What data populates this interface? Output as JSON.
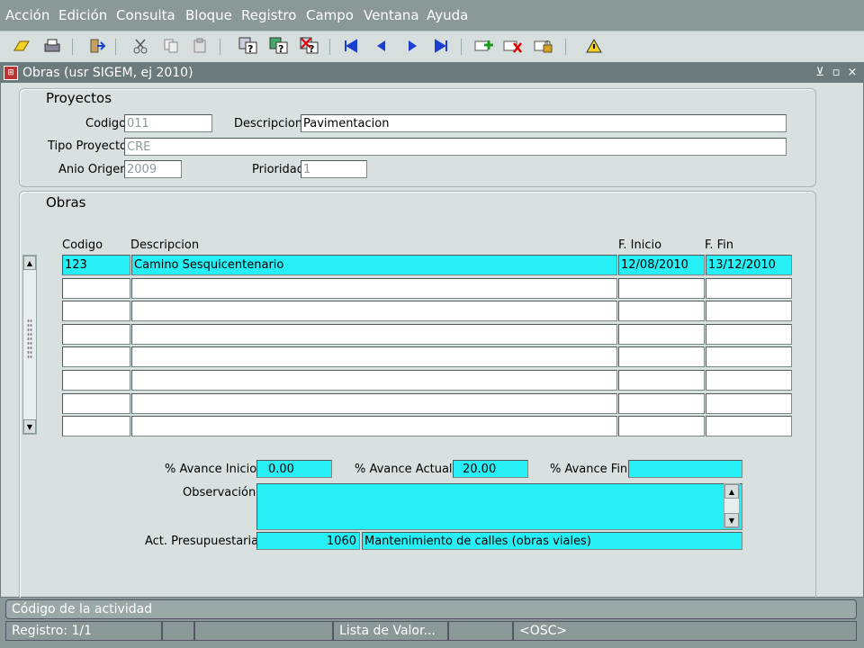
{
  "menu": [
    {
      "label": "Acción"
    },
    {
      "label": "Edición"
    },
    {
      "label": "Consulta"
    },
    {
      "label": "Bloque"
    },
    {
      "label": "Registro"
    },
    {
      "label": "Campo"
    },
    {
      "label": "Ventana"
    },
    {
      "label": "Ayuda"
    }
  ],
  "toolbar": {
    "icons": [
      "save-icon",
      "print-icon",
      "exit-icon",
      "cut-icon",
      "copy-icon",
      "paste-icon",
      "enter-query-icon",
      "execute-query-icon",
      "cancel-query-icon",
      "first-record-icon",
      "previous-record-icon",
      "next-record-icon",
      "last-record-icon",
      "insert-record-icon",
      "delete-record-icon",
      "lock-record-icon",
      "help-icon"
    ]
  },
  "window": {
    "title": "Obras (usr SIGEM, ej 2010)",
    "minimize": "⊻",
    "restore": "▫",
    "close": "×"
  },
  "proyectos": {
    "section_title": "Proyectos",
    "codigo_label": "Codigo",
    "codigo_value": "011",
    "descripcion_label": "Descripcion",
    "descripcion_value": "Pavimentacion",
    "tipo_label": "Tipo Proyecto",
    "tipo_value": "CRE",
    "anio_label": "Anio Origen",
    "anio_value": "2009",
    "prioridad_label": "Prioridad",
    "prioridad_value": "1"
  },
  "obras": {
    "section_title": "Obras",
    "columns": {
      "codigo": "Codigo",
      "descripcion": "Descripcion",
      "inicio": "F. Inicio",
      "fin": "F. Fin"
    },
    "rows": [
      {
        "codigo": "123",
        "descripcion": "Camino Sesquicentenario",
        "inicio": "12/08/2010",
        "fin": "13/12/2010"
      },
      {
        "codigo": "",
        "descripcion": "",
        "inicio": "",
        "fin": ""
      },
      {
        "codigo": "",
        "descripcion": "",
        "inicio": "",
        "fin": ""
      },
      {
        "codigo": "",
        "descripcion": "",
        "inicio": "",
        "fin": ""
      },
      {
        "codigo": "",
        "descripcion": "",
        "inicio": "",
        "fin": ""
      },
      {
        "codigo": "",
        "descripcion": "",
        "inicio": "",
        "fin": ""
      },
      {
        "codigo": "",
        "descripcion": "",
        "inicio": "",
        "fin": ""
      },
      {
        "codigo": "",
        "descripcion": "",
        "inicio": "",
        "fin": ""
      }
    ]
  },
  "detalle": {
    "avance_inicio_label": "% Avance Inicio",
    "avance_inicio_value": "0.00",
    "avance_actual_label": "% Avance Actual",
    "avance_actual_value": "20.00",
    "avance_fin_label": "% Avance Fin",
    "avance_fin_value": "",
    "observacion_label": "Observación",
    "observacion_value": "",
    "act_label": "Act. Presupuestaria",
    "act_code": "1060",
    "act_desc": "Mantenimiento de calles (obras viales)"
  },
  "status": {
    "message": "Código de la actividad",
    "registro": "Registro: 1/1",
    "lista": "Lista de Valor...",
    "osc": "<OSC>"
  },
  "colors": {
    "highlight": "#26f0f6",
    "frame": "#8a9898"
  }
}
